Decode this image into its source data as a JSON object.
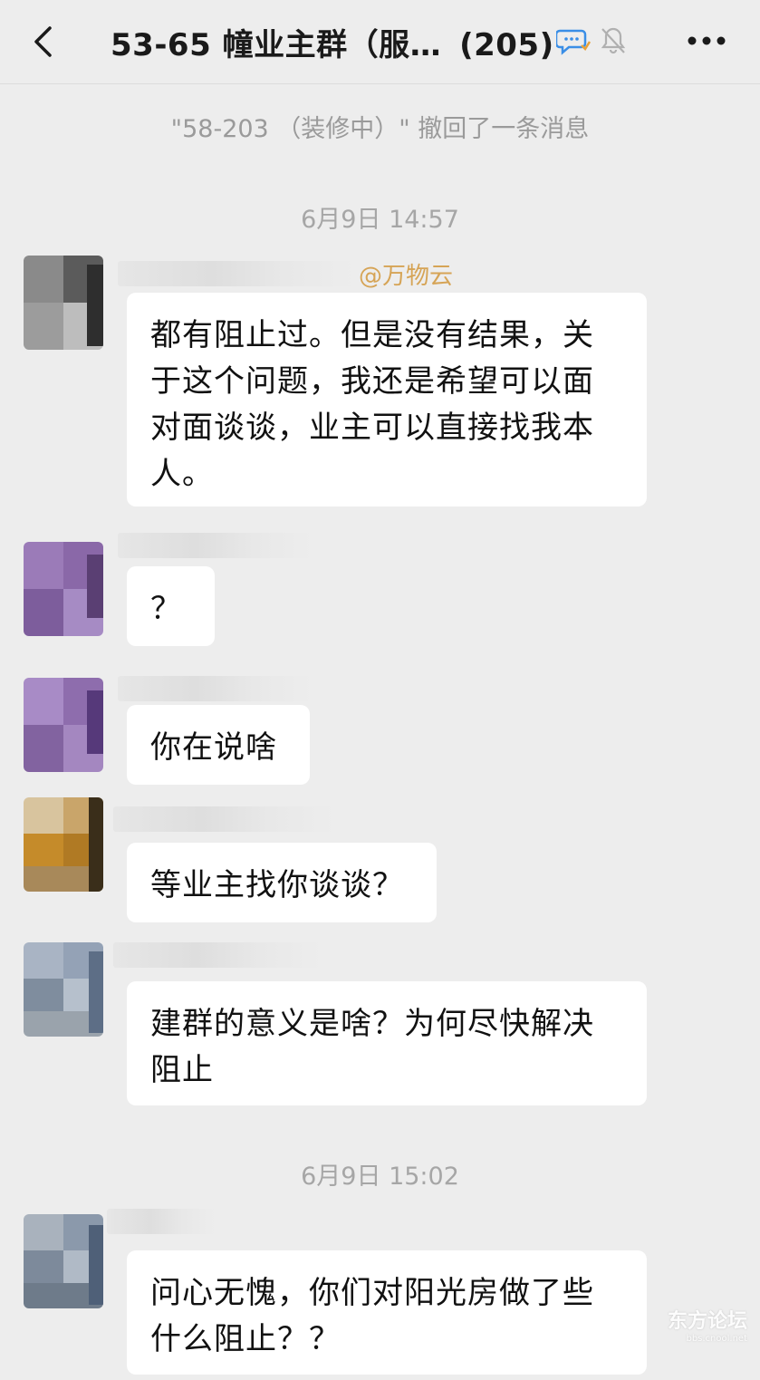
{
  "header": {
    "title": "53-65 幢业主群（服…",
    "member_count": "(205)",
    "back_icon": "back-chevron-icon",
    "chat_icon": "chat-bubble-icon",
    "mute_icon": "mute-bell-icon",
    "more_icon": "more-dots-icon"
  },
  "system_message": "\"58-203 （装修中）\" 撤回了一条消息",
  "timestamps": [
    "6月9日 14:57",
    "6月9日 15:02"
  ],
  "messages": [
    {
      "sender_tag": "@万物云",
      "text": "都有阻止过。但是没有结果，关\n于这个问题，我还是希望可以面\n对面谈谈，业主可以直接找我本\n人。"
    },
    {
      "sender_tag": "",
      "text": "？"
    },
    {
      "sender_tag": "",
      "text": "你在说啥"
    },
    {
      "sender_tag": "",
      "text": "等业主找你谈谈？"
    },
    {
      "sender_tag": "",
      "text": "建群的意义是啥？为何尽快解决\n阻止"
    },
    {
      "sender_tag": "",
      "text": "问心无愧，你们对阳光房做了些\n什么阻止？？"
    }
  ],
  "watermark": {
    "brand": "东方论坛",
    "url": "bbs.cnool.net"
  },
  "colors": {
    "background": "#ededed",
    "bubble": "#ffffff",
    "mention": "#d6a456",
    "meta_text": "#a6a6a6"
  }
}
